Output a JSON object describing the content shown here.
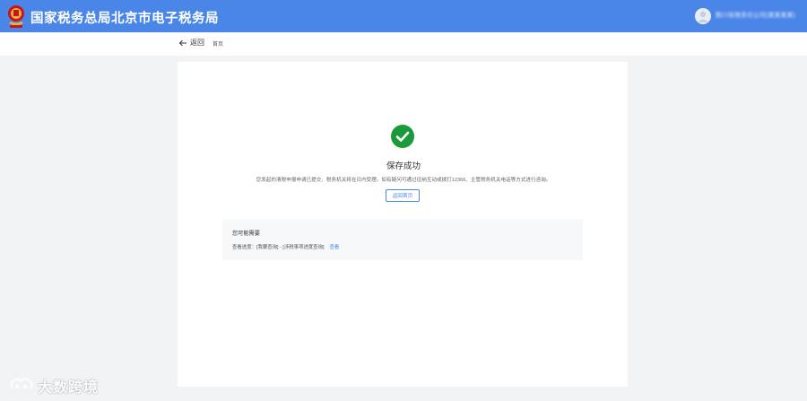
{
  "header": {
    "title": "国家税务总局北京市电子税务局",
    "user_name": "数川有限责任公司(某某某某)",
    "brand_color": "#4a86e8"
  },
  "subbar": {
    "back_label": "返回",
    "home_label": "首页"
  },
  "result": {
    "icon": "check-circle-icon",
    "status_color": "#1a9a3a",
    "title": "保存成功",
    "description": "您发起的清税申报申请已提交，税务机关将在日内受理。如有疑问可通过征纳互动或拨打12366、主管税务机关电话等方式进行咨询。",
    "home_button": "返回首页"
  },
  "needs": {
    "title": "您可能需要",
    "progress_label": "查看进度：",
    "progress_path": "[我要查询] - [涉税事项进度查询]",
    "view_link": "查看"
  },
  "watermark": {
    "text": "大数跨境"
  }
}
